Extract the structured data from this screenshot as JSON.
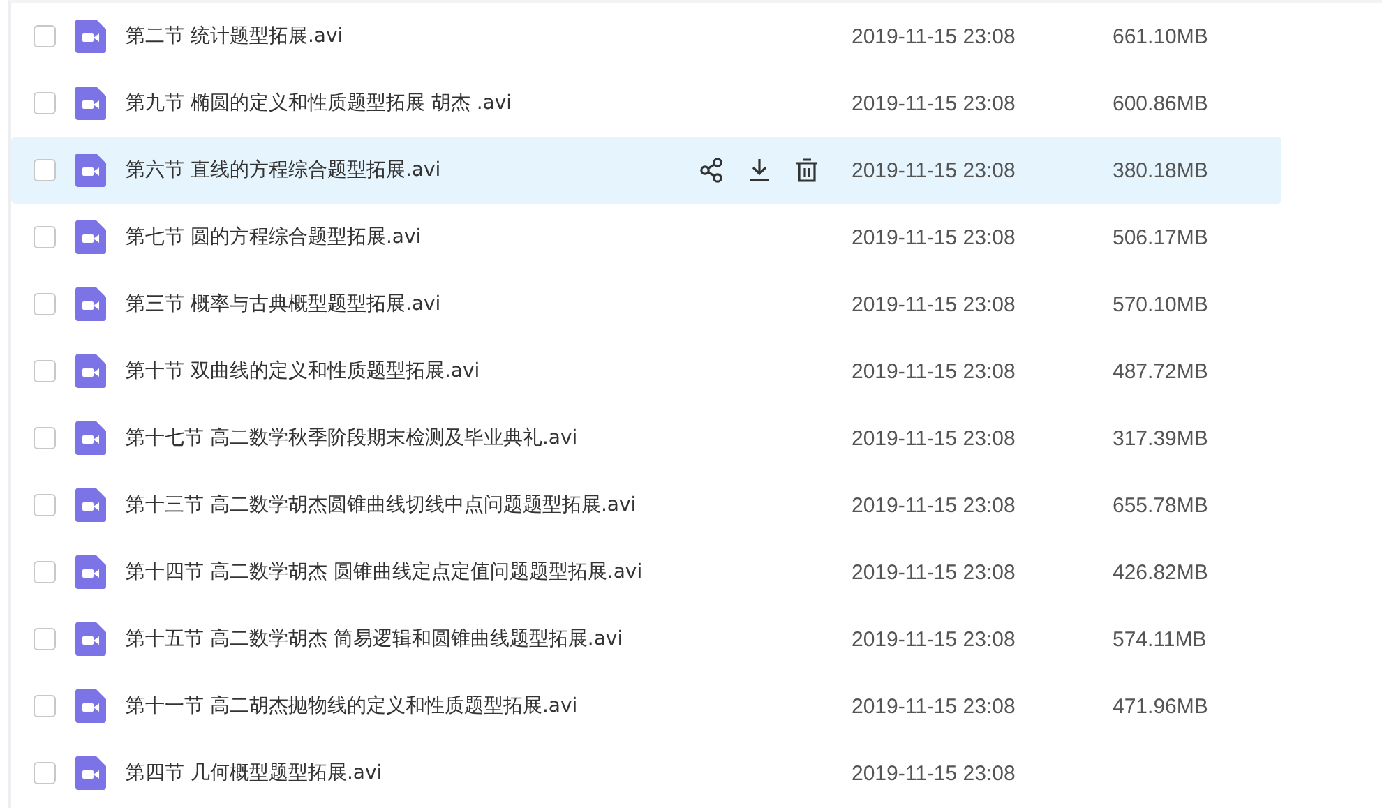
{
  "files": [
    {
      "name": "第二节 统计题型拓展.avi",
      "date": "2019-11-15 23:08",
      "size": "661.10MB",
      "checked": false,
      "hovered": false
    },
    {
      "name": "第九节 椭圆的定义和性质题型拓展 胡杰 .avi",
      "date": "2019-11-15 23:08",
      "size": "600.86MB",
      "checked": false,
      "hovered": false
    },
    {
      "name": "第六节 直线的方程综合题型拓展.avi",
      "date": "2019-11-15 23:08",
      "size": "380.18MB",
      "checked": false,
      "hovered": true
    },
    {
      "name": "第七节 圆的方程综合题型拓展.avi",
      "date": "2019-11-15 23:08",
      "size": "506.17MB",
      "checked": false,
      "hovered": false
    },
    {
      "name": "第三节 概率与古典概型题型拓展.avi",
      "date": "2019-11-15 23:08",
      "size": "570.10MB",
      "checked": false,
      "hovered": false
    },
    {
      "name": "第十节 双曲线的定义和性质题型拓展.avi",
      "date": "2019-11-15 23:08",
      "size": "487.72MB",
      "checked": false,
      "hovered": false
    },
    {
      "name": "第十七节 高二数学秋季阶段期末检测及毕业典礼.avi",
      "date": "2019-11-15 23:08",
      "size": "317.39MB",
      "checked": false,
      "hovered": false
    },
    {
      "name": "第十三节 高二数学胡杰圆锥曲线切线中点问题题型拓展.avi",
      "date": "2019-11-15 23:08",
      "size": "655.78MB",
      "checked": false,
      "hovered": false
    },
    {
      "name": "第十四节 高二数学胡杰 圆锥曲线定点定值问题题型拓展.avi",
      "date": "2019-11-15 23:08",
      "size": "426.82MB",
      "checked": false,
      "hovered": false
    },
    {
      "name": "第十五节 高二数学胡杰 简易逻辑和圆锥曲线题型拓展.avi",
      "date": "2019-11-15 23:08",
      "size": "574.11MB",
      "checked": false,
      "hovered": false
    },
    {
      "name": "第十一节 高二胡杰抛物线的定义和性质题型拓展.avi",
      "date": "2019-11-15 23:08",
      "size": "471.96MB",
      "checked": false,
      "hovered": false
    },
    {
      "name": "第四节 几何概型题型拓展.avi",
      "date": "2019-11-15 23:08",
      "checked": false,
      "hovered": false
    }
  ]
}
